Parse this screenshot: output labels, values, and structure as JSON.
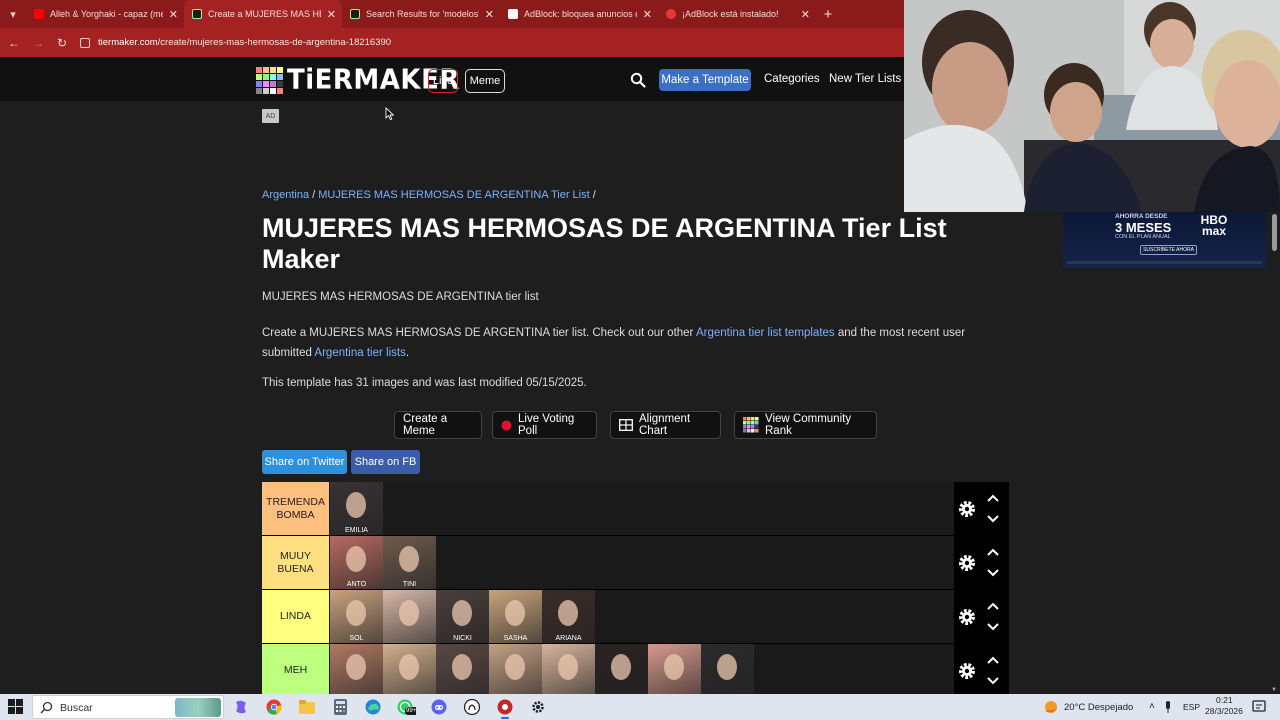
{
  "browser": {
    "tabs": [
      {
        "title": "Alleh & Yorghaki - capaz (merengue)",
        "favicon_color": "#ff0000",
        "active": false
      },
      {
        "title": "Create a MUJERES MAS HERMOSAS",
        "favicon_color": "#1b1b1b",
        "active": true
      },
      {
        "title": "Search Results for 'modelos' - TierMaker",
        "favicon_color": "#1b1b1b",
        "active": false
      },
      {
        "title": "AdBlock: bloquea anuncios en la web",
        "favicon_color": "#ffffff",
        "active": false
      },
      {
        "title": "¡AdBlock está instalado!",
        "favicon_color": "#e53935",
        "active": false
      }
    ],
    "url_domain": "tiermaker.com",
    "url_path": "/create/mujeres-mas-hermosas-de-argentina-18216390"
  },
  "header": {
    "logo_text": "TiERMAKER",
    "live_label": "Live",
    "meme_label": "Meme",
    "make_template_label": "Make a Template",
    "categories_label": "Categories",
    "new_tier_lists_label": "New Tier Lists",
    "logo_colors": [
      "#ff7f7f",
      "#ffbf7f",
      "#ffdf7f",
      "#ffff7f",
      "#bfff7f",
      "#7fff7f",
      "#7fffff",
      "#7fbfff",
      "#7f7fff",
      "#ff7fff",
      "#bf7fbf",
      "#3b3b3b",
      "#858585",
      "#cfcfcf",
      "#f7f7f7",
      "#ff7f7f"
    ]
  },
  "ad_badge": "AD",
  "breadcrumb": {
    "category": "Argentina",
    "separator": " / ",
    "current": "MUJERES MAS HERMOSAS DE ARGENTINA Tier List",
    "trail_end": " /"
  },
  "page": {
    "title": "MUJERES MAS HERMOSAS DE ARGENTINA Tier List Maker",
    "subtitle": "MUJERES MAS HERMOSAS DE ARGENTINA tier list",
    "desc_part1": "Create a MUJERES MAS HERMOSAS DE ARGENTINA tier list. Check out our other ",
    "desc_link1": "Argentina tier list templates",
    "desc_part2": " and the most recent user submitted ",
    "desc_link2": "Argentina tier lists",
    "desc_part3": ".",
    "meta": "This template has 31 images and was last modified 05/15/2025."
  },
  "actions": {
    "create_meme": "Create a Meme",
    "live_voting": "Live Voting Poll",
    "alignment_chart": "Alignment Chart",
    "community_rank": "View Community Rank"
  },
  "share": {
    "twitter": "Share on Twitter",
    "facebook": "Share on FB"
  },
  "tiers": [
    {
      "label": "TREMENDA BOMBA",
      "color": "#ffbf7f",
      "items": [
        {
          "name": "EMILIA",
          "tone": "#3a3234"
        }
      ]
    },
    {
      "label": "MUUY BUENA",
      "color": "#ffdf7f",
      "items": [
        {
          "name": "ANTO",
          "tone": "#b86a62"
        },
        {
          "name": "TINI",
          "tone": "#6e5a4c"
        }
      ]
    },
    {
      "label": "LINDA",
      "color": "#ffff7f",
      "items": [
        {
          "name": "SOL",
          "tone": "#c9a27e"
        },
        {
          "name": "",
          "tone": "#d7b8a8"
        },
        {
          "name": "NICKI",
          "tone": "#4a3e3c"
        },
        {
          "name": "SASHA",
          "tone": "#c8a47c"
        },
        {
          "name": "ARIANA",
          "tone": "#3a2c2a"
        }
      ]
    },
    {
      "label": "MEH",
      "color": "#bfff7f",
      "items": [
        {
          "name": "",
          "tone": "#b07a62"
        },
        {
          "name": "",
          "tone": "#d2b08e"
        },
        {
          "name": "",
          "tone": "#5a4844"
        },
        {
          "name": "",
          "tone": "#c4a084"
        },
        {
          "name": "",
          "tone": "#d8b49c"
        },
        {
          "name": "",
          "tone": "#2a2222"
        },
        {
          "name": "",
          "tone": "#d69a8c"
        },
        {
          "name": "",
          "tone": "#2c2a2c"
        }
      ]
    }
  ],
  "side_ad": {
    "line1": "AHORRA DESDE",
    "line2": "3 MESES",
    "line3": "CON EL PLAN ANUAL",
    "cta": "SUSCRÍBETE AHORA",
    "brand": "HBO max"
  },
  "taskbar": {
    "search_placeholder": "Buscar",
    "whatsapp_badge": "99+",
    "weather": "20°C  Despejado",
    "lang": "ESP",
    "time": "0:21",
    "date": "28/3/2026"
  }
}
